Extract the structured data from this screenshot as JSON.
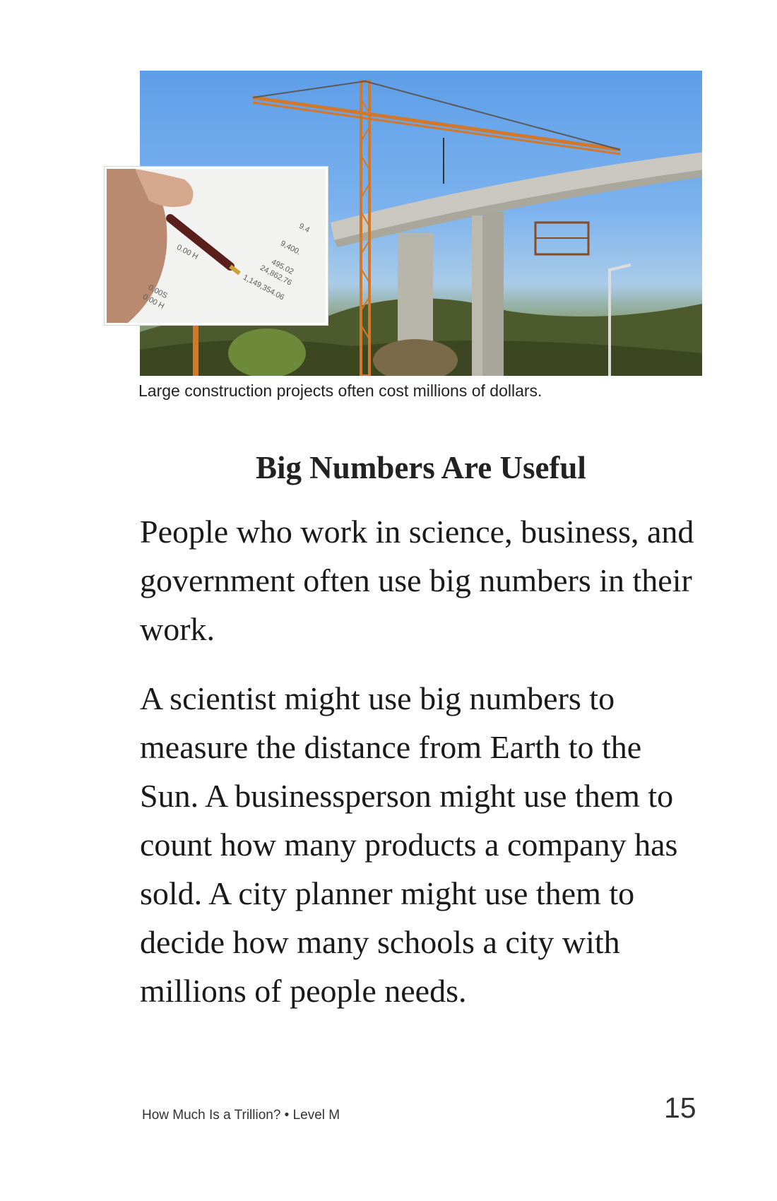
{
  "figure": {
    "inset_numbers": [
      "9.4",
      "9,400.",
      "495.02",
      "24,862.76",
      "1,149,354.06",
      "0.00 H",
      "0.00S",
      "0.00 H"
    ],
    "caption": "Large construction projects often cost millions of dollars."
  },
  "section": {
    "heading": "Big Numbers Are Useful",
    "paragraphs": [
      "People who work in science, business, and government often use big numbers in their work.",
      "A scientist might use big numbers to measure the distance from Earth to the Sun. A businessperson might use them to count how many products a company has sold. A city planner might use them to decide how many schools a city with millions of people needs."
    ]
  },
  "footer": {
    "book_title": "How Much Is a Trillion? • Level M",
    "page_number": "15"
  }
}
